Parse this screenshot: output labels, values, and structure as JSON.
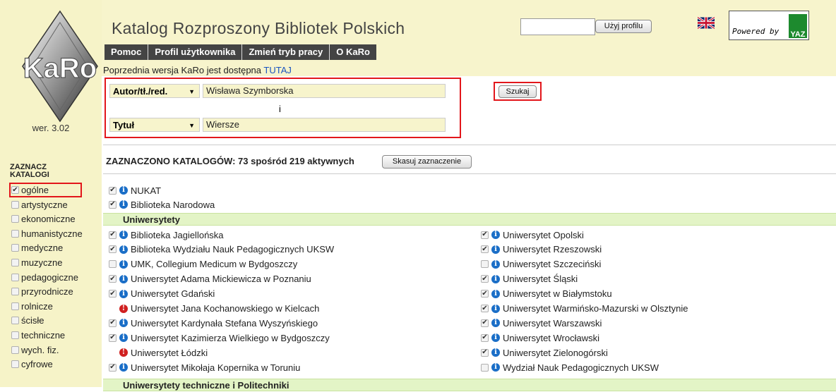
{
  "sidebar": {
    "logo_text": "KaRo",
    "version": "wer. 3.02",
    "select_heading_1": "ZAZNACZ",
    "select_heading_2": "KATALOGI",
    "categories": [
      {
        "label": "ogólne",
        "checked": true
      },
      {
        "label": "artystyczne",
        "checked": false
      },
      {
        "label": "ekonomiczne",
        "checked": false
      },
      {
        "label": "humanistyczne",
        "checked": false
      },
      {
        "label": "medyczne",
        "checked": false
      },
      {
        "label": "muzyczne",
        "checked": false
      },
      {
        "label": "pedagogiczne",
        "checked": false
      },
      {
        "label": "przyrodnicze",
        "checked": false
      },
      {
        "label": "rolnicze",
        "checked": false
      },
      {
        "label": "ścisłe",
        "checked": false
      },
      {
        "label": "techniczne",
        "checked": false
      },
      {
        "label": "wych. fiz.",
        "checked": false
      },
      {
        "label": "cyfrowe",
        "checked": false
      }
    ]
  },
  "header": {
    "title": "Katalog Rozproszony Bibliotek Polskich",
    "menu": [
      "Pomoc",
      "Profil użytkownika",
      "Zmień tryb pracy",
      "O KaRo"
    ],
    "prev_text": "Poprzednia wersja KaRo jest dostępna ",
    "prev_link": "TUTAJ",
    "profile_value": "",
    "profile_button": "Użyj profilu",
    "powered_by": "Powered by",
    "yaz": "YAZ"
  },
  "search": {
    "field1_select": "Autor/tł./red.",
    "field1_value": "Wisława Szymborska",
    "conjunction": "i",
    "field2_select": "Tytuł",
    "field2_value": "Wiersze",
    "search_button": "Szukaj"
  },
  "catalogs": {
    "count_text": "ZAZNACZONO KATALOGÓW: 73 spośród 219 aktywnych",
    "clear_button": "Skasuj zaznaczenie",
    "top": [
      {
        "label": "NUKAT",
        "checked": true,
        "error": false
      },
      {
        "label": "Biblioteka Narodowa",
        "checked": true,
        "error": false
      }
    ],
    "group1": "Uniwersytety",
    "left": [
      {
        "label": "Biblioteka Jagiellońska",
        "checked": true,
        "error": false
      },
      {
        "label": "Biblioteka Wydziału Nauk Pedagogicznych UKSW",
        "checked": true,
        "error": false
      },
      {
        "label": "UMK, Collegium Medicum w Bydgoszczy",
        "checked": false,
        "error": false
      },
      {
        "label": "Uniwersytet Adama Mickiewicza w Poznaniu",
        "checked": true,
        "error": false
      },
      {
        "label": "Uniwersytet Gdański",
        "checked": true,
        "error": false
      },
      {
        "label": "Uniwersytet Jana Kochanowskiego w Kielcach",
        "checked": null,
        "error": true
      },
      {
        "label": "Uniwersytet Kardynała Stefana Wyszyńskiego",
        "checked": true,
        "error": false
      },
      {
        "label": "Uniwersytet Kazimierza Wielkiego w Bydgoszczy",
        "checked": true,
        "error": false
      },
      {
        "label": "Uniwersytet Łódzki",
        "checked": null,
        "error": true
      },
      {
        "label": "Uniwersytet Mikołaja Kopernika w Toruniu",
        "checked": true,
        "error": false
      }
    ],
    "right": [
      {
        "label": "Uniwersytet Opolski",
        "checked": true,
        "error": false
      },
      {
        "label": "Uniwersytet Rzeszowski",
        "checked": true,
        "error": false
      },
      {
        "label": "Uniwersytet Szczeciński",
        "checked": false,
        "error": false
      },
      {
        "label": "Uniwersytet Śląski",
        "checked": true,
        "error": false
      },
      {
        "label": "Uniwersytet w Białymstoku",
        "checked": true,
        "error": false
      },
      {
        "label": "Uniwersytet Warmińsko-Mazurski w Olsztynie",
        "checked": true,
        "error": false
      },
      {
        "label": "Uniwersytet Warszawski",
        "checked": true,
        "error": false
      },
      {
        "label": "Uniwersytet Wrocławski",
        "checked": true,
        "error": false
      },
      {
        "label": "Uniwersytet Zielonogórski",
        "checked": true,
        "error": false
      },
      {
        "label": "Wydział Nauk Pedagogicznych UKSW",
        "checked": false,
        "error": false
      }
    ],
    "group2": "Uniwersytety techniczne i Politechniki"
  }
}
